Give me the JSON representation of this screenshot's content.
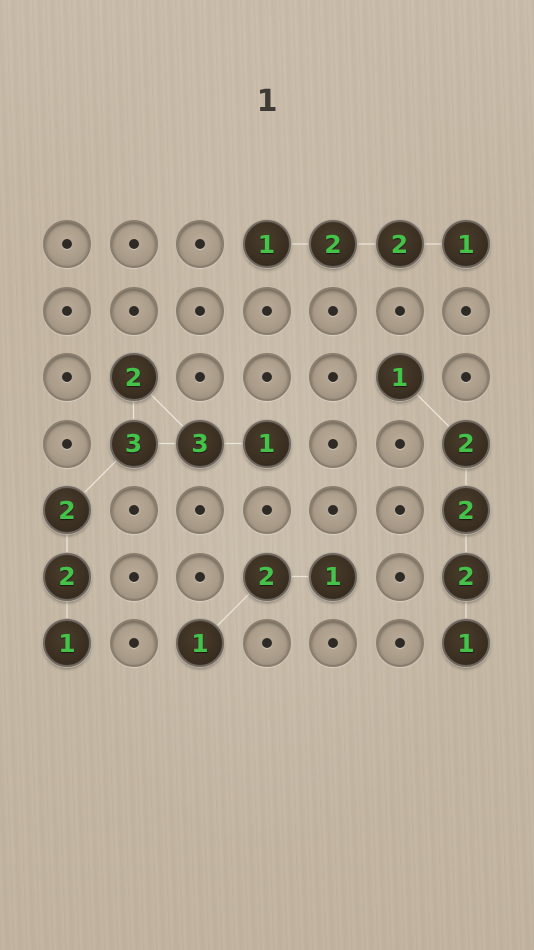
{
  "level": "1",
  "board": {
    "rows": 7,
    "cols": 7,
    "cells": [
      [
        null,
        null,
        null,
        1,
        2,
        2,
        1
      ],
      [
        null,
        null,
        null,
        null,
        null,
        null,
        null
      ],
      [
        null,
        2,
        null,
        null,
        null,
        1,
        null
      ],
      [
        null,
        3,
        3,
        1,
        null,
        null,
        2
      ],
      [
        2,
        null,
        null,
        null,
        null,
        null,
        2
      ],
      [
        2,
        null,
        null,
        2,
        1,
        null,
        2
      ],
      [
        1,
        null,
        1,
        null,
        null,
        null,
        1
      ]
    ],
    "links": [
      [
        [
          0,
          3
        ],
        [
          0,
          4
        ]
      ],
      [
        [
          0,
          4
        ],
        [
          0,
          5
        ]
      ],
      [
        [
          0,
          5
        ],
        [
          0,
          6
        ]
      ],
      [
        [
          2,
          1
        ],
        [
          3,
          1
        ]
      ],
      [
        [
          2,
          1
        ],
        [
          3,
          2
        ]
      ],
      [
        [
          3,
          1
        ],
        [
          3,
          2
        ]
      ],
      [
        [
          3,
          2
        ],
        [
          3,
          3
        ]
      ],
      [
        [
          3,
          1
        ],
        [
          4,
          0
        ]
      ],
      [
        [
          4,
          0
        ],
        [
          5,
          0
        ]
      ],
      [
        [
          5,
          0
        ],
        [
          6,
          0
        ]
      ],
      [
        [
          2,
          5
        ],
        [
          3,
          6
        ]
      ],
      [
        [
          3,
          6
        ],
        [
          4,
          6
        ]
      ],
      [
        [
          4,
          6
        ],
        [
          5,
          6
        ]
      ],
      [
        [
          5,
          6
        ],
        [
          6,
          6
        ]
      ],
      [
        [
          5,
          3
        ],
        [
          5,
          4
        ]
      ],
      [
        [
          5,
          3
        ],
        [
          6,
          2
        ]
      ]
    ]
  },
  "colors": {
    "number": "#44c24a",
    "link": "#f2ece2",
    "node": "#3a2f21",
    "level_text": "#3e3a36"
  }
}
